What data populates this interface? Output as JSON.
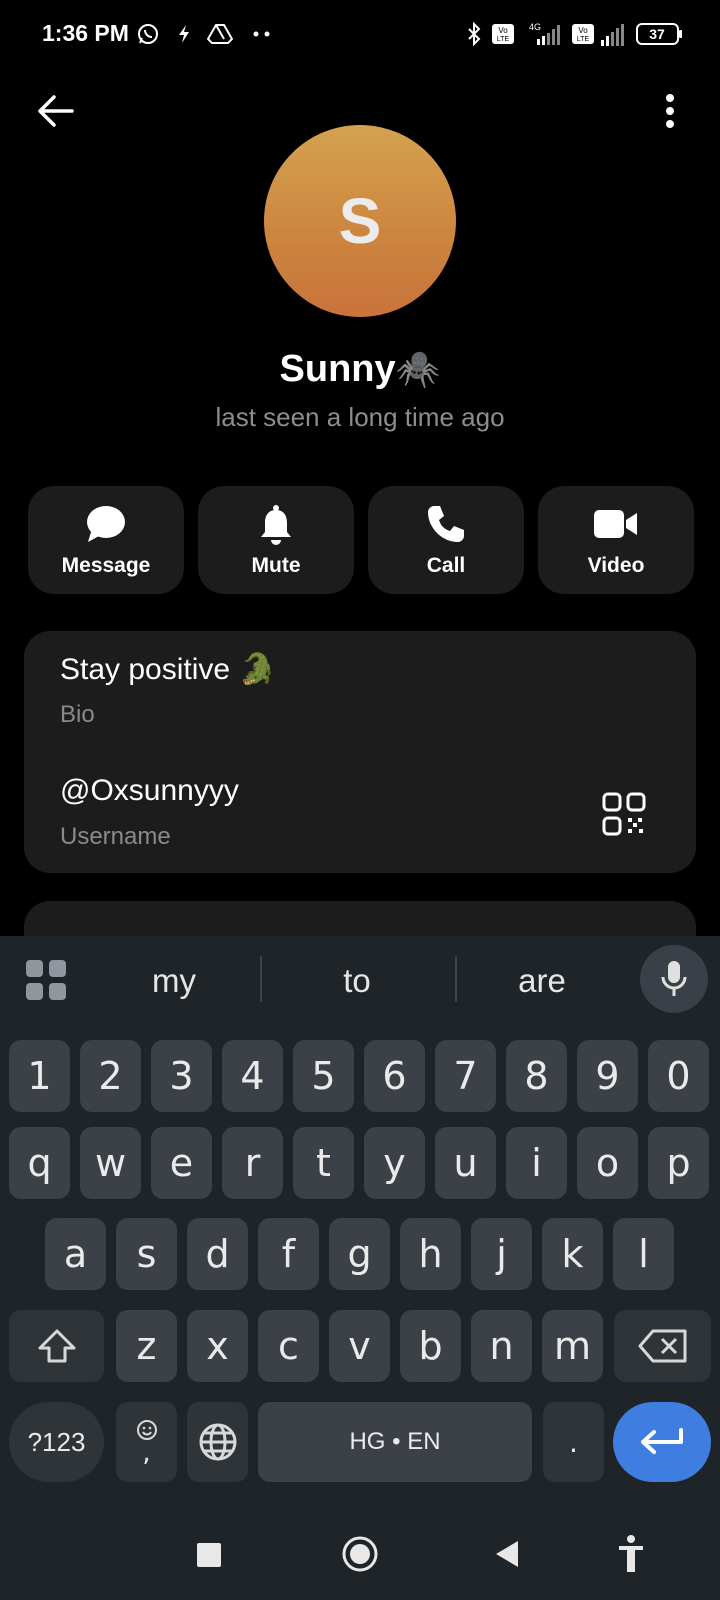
{
  "status_bar": {
    "time": "1:36 PM",
    "battery": "37",
    "network": "4G",
    "icons": [
      "whatsapp-icon",
      "flash-icon",
      "drive-icon",
      "more-dots-icon",
      "bluetooth-icon",
      "volte-icon",
      "signal-icon",
      "battery-icon"
    ]
  },
  "profile": {
    "avatar_letter": "S",
    "name": "Sunny",
    "name_emoji": "🕷️",
    "status": "last seen a long time ago",
    "avatar_colors": [
      "#d4a24f",
      "#c9733a"
    ]
  },
  "actions": [
    {
      "label": "Message",
      "icon": "chat-bubble-icon"
    },
    {
      "label": "Mute",
      "icon": "bell-icon"
    },
    {
      "label": "Call",
      "icon": "phone-icon"
    },
    {
      "label": "Video",
      "icon": "video-camera-icon"
    }
  ],
  "info": {
    "bio": "Stay positive",
    "bio_emoji": "🐊",
    "bio_label": "Bio",
    "username": "@Oxsunnyyy",
    "username_label": "Username"
  },
  "keyboard": {
    "suggestions": [
      "my",
      "to",
      "are"
    ],
    "row_numbers": [
      "1",
      "2",
      "3",
      "4",
      "5",
      "6",
      "7",
      "8",
      "9",
      "0"
    ],
    "row_1": [
      "q",
      "w",
      "e",
      "r",
      "t",
      "y",
      "u",
      "i",
      "o",
      "p"
    ],
    "row_2": [
      "a",
      "s",
      "d",
      "f",
      "g",
      "h",
      "j",
      "k",
      "l"
    ],
    "row_3": [
      "z",
      "x",
      "c",
      "v",
      "b",
      "n",
      "m"
    ],
    "symbols_label": "?123",
    "emoji_comma": ",",
    "space_label": "HG • EN",
    "period": "."
  },
  "colors": {
    "background": "#000000",
    "card": "#1c1c1c",
    "keyboard": "#1f2428",
    "key": "#3c4147",
    "enter": "#3f7ee0"
  }
}
